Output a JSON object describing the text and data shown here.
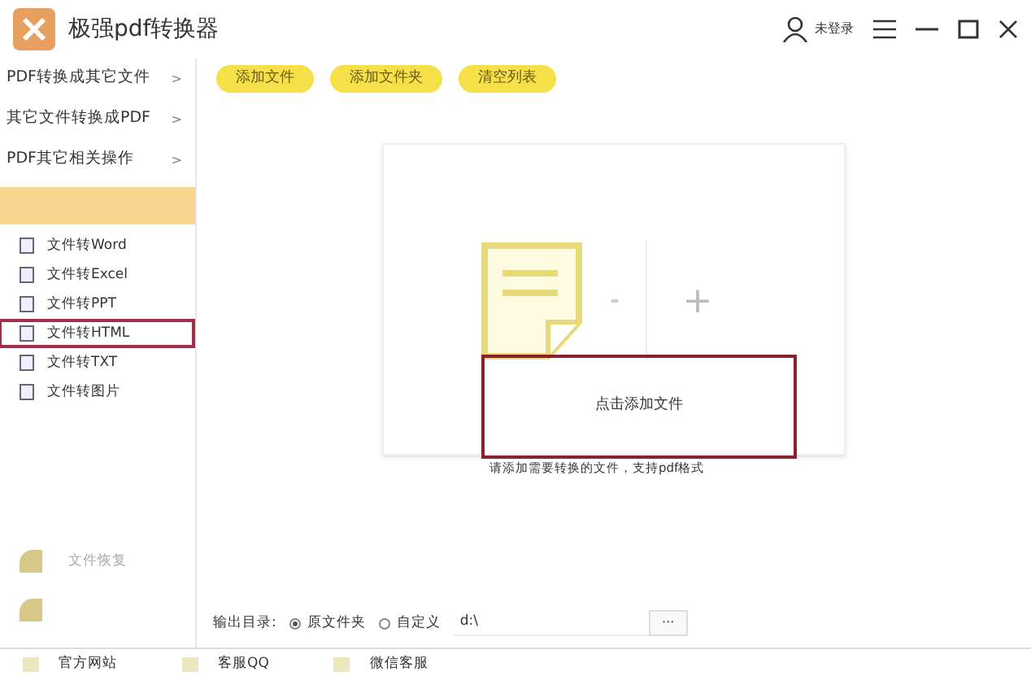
{
  "window": {
    "title": "极强pdf转换器",
    "user": "未登录"
  },
  "sidebar": {
    "menus": [
      {
        "label": "PDF转换成其它文件",
        "arrow": ">"
      },
      {
        "label": "其它文件转换成PDF",
        "arrow": ">"
      },
      {
        "label": "PDF其它相关操作",
        "arrow": ">"
      }
    ],
    "items": [
      {
        "label": "文件转Word",
        "selected": false
      },
      {
        "label": "文件转Excel",
        "selected": false
      },
      {
        "label": "文件转PPT",
        "selected": false
      },
      {
        "label": "文件转HTML",
        "selected": true
      },
      {
        "label": "文件转TXT",
        "selected": false
      },
      {
        "label": "文件转图片",
        "selected": false
      }
    ],
    "bottom_items": [
      {
        "label": "文件恢复"
      }
    ]
  },
  "toolbar": [
    "添加文件",
    "添加文件夹",
    "清空列表"
  ],
  "drop_area": {
    "action": "点击添加文件",
    "minus": "-",
    "plus": "+",
    "hint": "请添加需要转换的文件，支持pdf格式"
  },
  "output": {
    "label": "输出目录:",
    "options": [
      {
        "label": "原文件夹",
        "selected": true
      },
      {
        "label": "自定义",
        "selected": false
      }
    ],
    "path": "d:\\",
    "browse": "···"
  },
  "footer": [
    "官方网站",
    "客服QQ",
    "微信客服"
  ]
}
